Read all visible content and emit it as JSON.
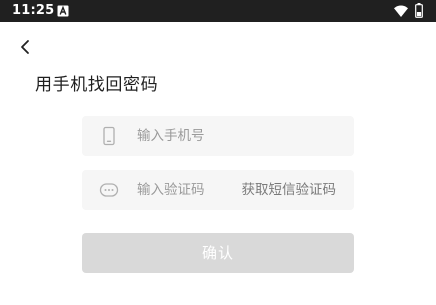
{
  "status_bar": {
    "time": "11:25",
    "icons": [
      "notification-a-icon",
      "wifi-icon",
      "battery-icon"
    ]
  },
  "header": {
    "back_icon": "chevron-left-icon"
  },
  "page": {
    "title": "用手机找回密码"
  },
  "form": {
    "phone": {
      "icon": "phone-icon",
      "placeholder": "输入手机号",
      "value": ""
    },
    "code": {
      "icon": "message-bubble-icon",
      "placeholder": "输入验证码",
      "value": "",
      "get_code_label": "获取短信验证码"
    },
    "confirm_label": "确认"
  },
  "colors": {
    "status_bar_bg": "#202020",
    "field_bg": "#f6f6f6",
    "button_disabled_bg": "#d9d9d9",
    "placeholder_text": "#9a9a9a",
    "title_text": "#1f1f1f"
  }
}
